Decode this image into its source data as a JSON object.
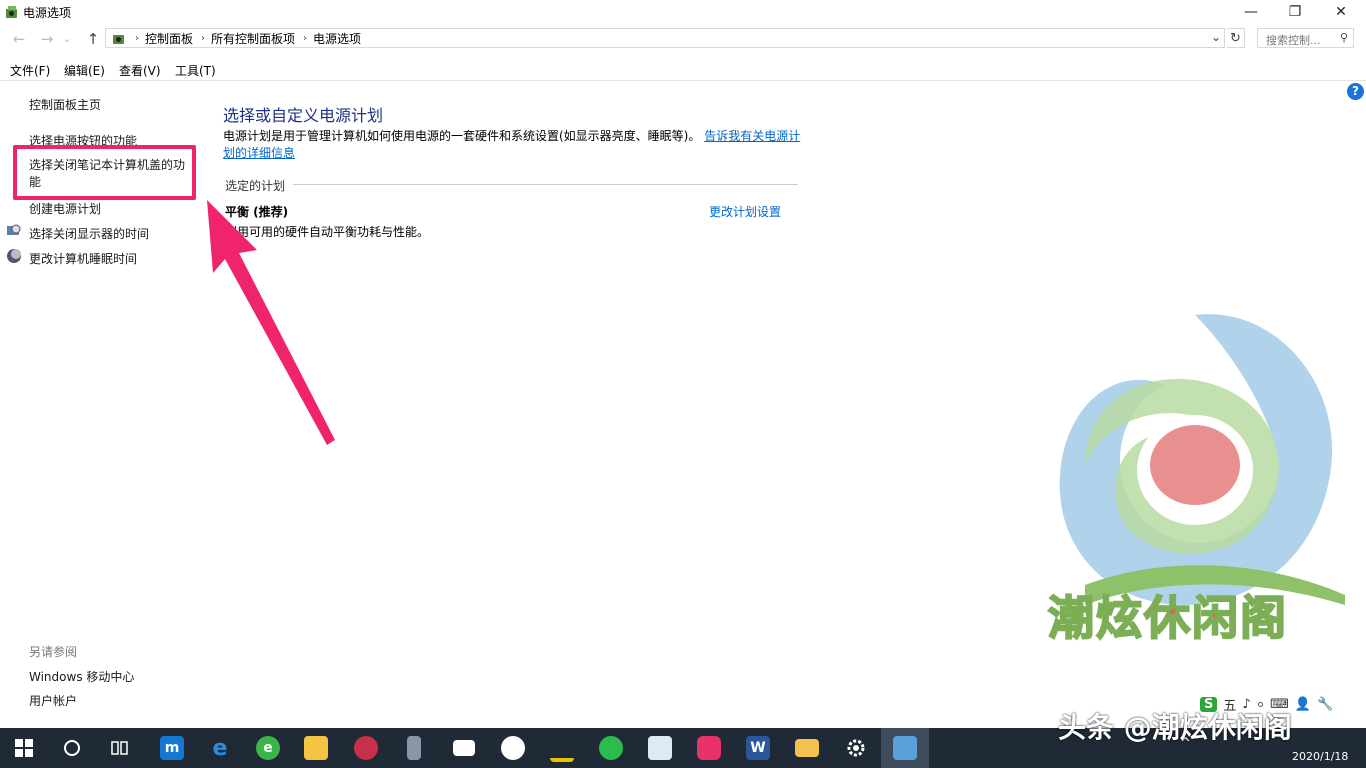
{
  "window": {
    "title": "电源选项",
    "minimize": "—",
    "restore": "❐",
    "close": "✕"
  },
  "nav": {
    "back": "←",
    "forward": "→",
    "recent": "⌄",
    "up": "↑",
    "breadcrumb": [
      "控制面板",
      "所有控制面板项",
      "电源选项"
    ],
    "separator": "›",
    "dropdown": "⌄",
    "refresh": "↻",
    "search_placeholder": "搜索控制...",
    "search_icon": "⚲"
  },
  "menu": [
    "文件(F)",
    "编辑(E)",
    "查看(V)",
    "工具(T)"
  ],
  "sidebar": {
    "home": "控制面板主页",
    "items": [
      "选择电源按钮的功能",
      "选择关闭笔记本计算机盖的功能",
      "创建电源计划",
      "选择关闭显示器的时间",
      "更改计算机睡眠时间"
    ],
    "see_also_label": "另请参阅",
    "see_also": [
      "Windows 移动中心",
      "用户帐户"
    ]
  },
  "main": {
    "heading": "选择或自定义电源计划",
    "description": "电源计划是用于管理计算机如何使用电源的一套硬件和系统设置(如显示器亮度、睡眠等)。",
    "description_link": "告诉我有关电源计划的详细信息",
    "selected_plan_label": "选定的计划",
    "plan_name": "平衡 (推荐)",
    "plan_desc": "利用可用的硬件自动平衡功耗与性能。",
    "change_plan": "更改计划设置",
    "help": "?"
  },
  "watermark": {
    "logo_text": "潮炫休闲阁",
    "corner_text": "头条 @潮炫休闲阁"
  },
  "ime": [
    "S",
    "五",
    "♪",
    "⸰",
    "⌨",
    "👤",
    "🔧"
  ],
  "taskbar": {
    "date": "2020/1/18",
    "tray_arrow": "^"
  },
  "colors": {
    "accent_link": "#0066cc",
    "heading": "#1e3287",
    "highlight": "#f0246c",
    "taskbar": "#1f2a36"
  }
}
